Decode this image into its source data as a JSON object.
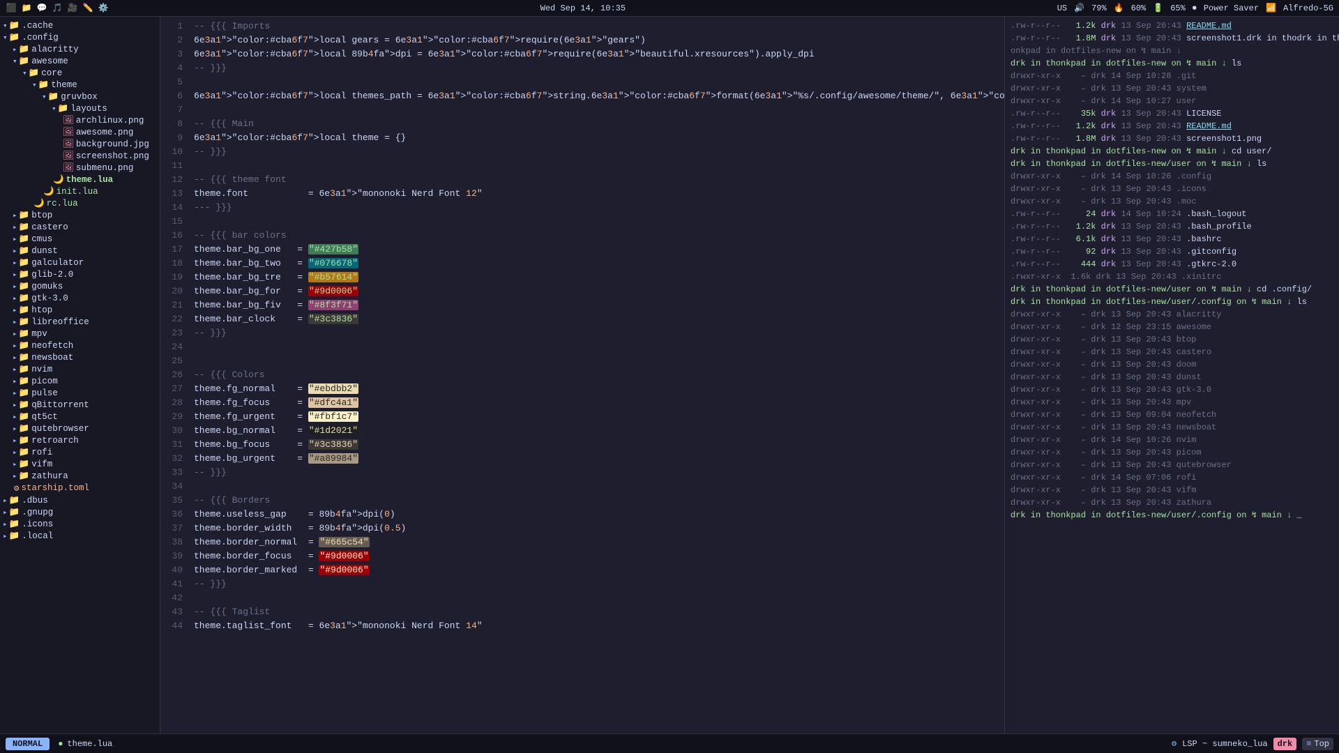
{
  "topbar": {
    "center": "Wed Sep 14, 10:35",
    "us_label": "US",
    "vol_label": "79%",
    "cpu_label": "60%",
    "battery_label": "65%",
    "power_label": "Power Saver",
    "wifi_label": "Alfredo-5G"
  },
  "sidebar": {
    "items": [
      {
        "label": ".cache",
        "type": "folder",
        "indent": 0,
        "expanded": true
      },
      {
        "label": ".config",
        "type": "folder",
        "indent": 0,
        "expanded": true
      },
      {
        "label": "alacritty",
        "type": "folder",
        "indent": 1,
        "expanded": false
      },
      {
        "label": "awesome",
        "type": "folder",
        "indent": 1,
        "expanded": true
      },
      {
        "label": "core",
        "type": "folder",
        "indent": 2,
        "expanded": true
      },
      {
        "label": "theme",
        "type": "folder",
        "indent": 3,
        "expanded": true
      },
      {
        "label": "gruvbox",
        "type": "folder",
        "indent": 4,
        "expanded": true
      },
      {
        "label": "layouts",
        "type": "folder",
        "indent": 5,
        "expanded": true
      },
      {
        "label": "archlinux.png",
        "type": "img",
        "indent": 6
      },
      {
        "label": "awesome.png",
        "type": "img",
        "indent": 6
      },
      {
        "label": "background.jpg",
        "type": "img",
        "indent": 6
      },
      {
        "label": "screenshot.png",
        "type": "img",
        "indent": 6
      },
      {
        "label": "submenu.png",
        "type": "img",
        "indent": 6
      },
      {
        "label": "theme.lua",
        "type": "lua-active",
        "indent": 5
      },
      {
        "label": "init.lua",
        "type": "lua",
        "indent": 4
      },
      {
        "label": "rc.lua",
        "type": "lua",
        "indent": 3
      },
      {
        "label": "btop",
        "type": "folder",
        "indent": 1,
        "expanded": false
      },
      {
        "label": "castero",
        "type": "folder",
        "indent": 1,
        "expanded": false
      },
      {
        "label": "cmus",
        "type": "folder",
        "indent": 1,
        "expanded": false
      },
      {
        "label": "dunst",
        "type": "folder",
        "indent": 1,
        "expanded": false
      },
      {
        "label": "galculator",
        "type": "folder",
        "indent": 1,
        "expanded": false
      },
      {
        "label": "glib-2.0",
        "type": "folder",
        "indent": 1,
        "expanded": false
      },
      {
        "label": "gomuks",
        "type": "folder",
        "indent": 1,
        "expanded": false
      },
      {
        "label": "gtk-3.0",
        "type": "folder",
        "indent": 1,
        "expanded": false
      },
      {
        "label": "htop",
        "type": "folder",
        "indent": 1,
        "expanded": false
      },
      {
        "label": "libreoffice",
        "type": "folder",
        "indent": 1,
        "expanded": false
      },
      {
        "label": "mpv",
        "type": "folder",
        "indent": 1,
        "expanded": false
      },
      {
        "label": "neofetch",
        "type": "folder",
        "indent": 1,
        "expanded": false
      },
      {
        "label": "newsboat",
        "type": "folder",
        "indent": 1,
        "expanded": false
      },
      {
        "label": "nvim",
        "type": "folder",
        "indent": 1,
        "expanded": false
      },
      {
        "label": "picom",
        "type": "folder",
        "indent": 1,
        "expanded": false
      },
      {
        "label": "pulse",
        "type": "folder",
        "indent": 1,
        "expanded": false
      },
      {
        "label": "qBittorrent",
        "type": "folder",
        "indent": 1,
        "expanded": false
      },
      {
        "label": "qt5ct",
        "type": "folder",
        "indent": 1,
        "expanded": false
      },
      {
        "label": "qutebrowser",
        "type": "folder",
        "indent": 1,
        "expanded": false
      },
      {
        "label": "retroarch",
        "type": "folder",
        "indent": 1,
        "expanded": false
      },
      {
        "label": "rofi",
        "type": "folder",
        "indent": 1,
        "expanded": false
      },
      {
        "label": "vifm",
        "type": "folder",
        "indent": 1,
        "expanded": false
      },
      {
        "label": "zathura",
        "type": "folder",
        "indent": 1,
        "expanded": false
      },
      {
        "label": "starship.toml",
        "type": "toml",
        "indent": 1
      },
      {
        "label": ".dbus",
        "type": "folder",
        "indent": 0,
        "expanded": false
      },
      {
        "label": ".gnupg",
        "type": "folder",
        "indent": 0,
        "expanded": false
      },
      {
        "label": ".icons",
        "type": "folder",
        "indent": 0,
        "expanded": false
      },
      {
        "label": ".local",
        "type": "folder",
        "indent": 0,
        "expanded": false
      }
    ]
  },
  "editor": {
    "filename": "theme.lua",
    "lines": [
      {
        "num": 1,
        "content": "-- {{{ Imports",
        "type": "comment"
      },
      {
        "num": 2,
        "content": "local gears = require(\"gears\")",
        "type": "code"
      },
      {
        "num": 3,
        "content": "local dpi = require(\"beautiful.xresources\").apply_dpi",
        "type": "code"
      },
      {
        "num": 4,
        "content": "-- }}}",
        "type": "comment"
      },
      {
        "num": 5,
        "content": "",
        "type": "blank"
      },
      {
        "num": 6,
        "content": "local themes_path = string.format(\"%s/.config/awesome/theme/\", os.getenv(\"HOME\"))",
        "type": "code"
      },
      {
        "num": 7,
        "content": "",
        "type": "blank"
      },
      {
        "num": 8,
        "content": "-- {{{ Main",
        "type": "comment"
      },
      {
        "num": 9,
        "content": "local theme = {}",
        "type": "code"
      },
      {
        "num": 10,
        "content": "-- }}}",
        "type": "comment"
      },
      {
        "num": 11,
        "content": "",
        "type": "blank"
      },
      {
        "num": 12,
        "content": "-- {{{ theme font",
        "type": "comment"
      },
      {
        "num": 13,
        "content": "theme.font           = \"mononoki Nerd Font 12\"",
        "type": "code"
      },
      {
        "num": 14,
        "content": "--- }}}",
        "type": "comment"
      },
      {
        "num": 15,
        "content": "",
        "type": "blank"
      },
      {
        "num": 16,
        "content": "-- {{{ bar colors",
        "type": "comment"
      },
      {
        "num": 17,
        "content": "theme.bar_bg_one   = \"#427b58\"",
        "type": "code",
        "highlight": "hl1"
      },
      {
        "num": 18,
        "content": "theme.bar_bg_two   = \"#076678\"",
        "type": "code",
        "highlight": "hl2"
      },
      {
        "num": 19,
        "content": "theme.bar_bg_tre   = \"#b57614\"",
        "type": "code",
        "highlight": "hl3"
      },
      {
        "num": 20,
        "content": "theme.bar_bg_for   = \"#9d0006\"",
        "type": "code",
        "highlight": "hl4"
      },
      {
        "num": 21,
        "content": "theme.bar_bg_fiv   = \"#8f3f71\"",
        "type": "code",
        "highlight": "hl5"
      },
      {
        "num": 22,
        "content": "theme.bar_clock    = \"#3c3836\"",
        "type": "code",
        "highlight": "hl6"
      },
      {
        "num": 23,
        "content": "-- }}}",
        "type": "comment"
      },
      {
        "num": 24,
        "content": "",
        "type": "blank"
      },
      {
        "num": 25,
        "content": "",
        "type": "blank"
      },
      {
        "num": 26,
        "content": "-- {{{ Colors",
        "type": "comment"
      },
      {
        "num": 27,
        "content": "theme.fg_normal    = \"#ebdbb2\"",
        "type": "code",
        "highlight": "hl7"
      },
      {
        "num": 28,
        "content": "theme.fg_focus     = \"#dfc4a1\"",
        "type": "code",
        "highlight": "hl8"
      },
      {
        "num": 29,
        "content": "theme.fg_urgent    = \"#fbf1c7\"",
        "type": "code",
        "highlight": "hl9"
      },
      {
        "num": 30,
        "content": "theme.bg_normal    = \"#1d2021\"",
        "type": "code",
        "highlight": "hla"
      },
      {
        "num": 31,
        "content": "theme.bg_focus     = \"#3c3836\"",
        "type": "code",
        "highlight": "hlb"
      },
      {
        "num": 32,
        "content": "theme.bg_urgent    = \"#a89984\"",
        "type": "code",
        "highlight": "hlc"
      },
      {
        "num": 33,
        "content": "-- }}}",
        "type": "comment"
      },
      {
        "num": 34,
        "content": "",
        "type": "blank"
      },
      {
        "num": 35,
        "content": "-- {{{ Borders",
        "type": "comment"
      },
      {
        "num": 36,
        "content": "theme.useless_gap    = dpi(0)",
        "type": "code"
      },
      {
        "num": 37,
        "content": "theme.border_width   = dpi(0.5)",
        "type": "code"
      },
      {
        "num": 38,
        "content": "theme.border_normal  = \"#665c54\"",
        "type": "code",
        "highlight": "hld"
      },
      {
        "num": 39,
        "content": "theme.border_focus   = \"#9d0006\"",
        "type": "code",
        "highlight": "hle"
      },
      {
        "num": 40,
        "content": "theme.border_marked  = \"#9d0006\"",
        "type": "code",
        "highlight": "hle"
      },
      {
        "num": 41,
        "content": "-- }}}",
        "type": "comment"
      },
      {
        "num": 42,
        "content": "",
        "type": "blank"
      },
      {
        "num": 43,
        "content": "-- {{{ Taglist",
        "type": "comment"
      },
      {
        "num": 44,
        "content": "theme.taglist_font   = \"mononoki Nerd Font 14\"",
        "type": "code"
      }
    ]
  },
  "terminal": {
    "lines": [
      ".rw-r--r--  1.2k drk 13 Sep 20:43 README.md",
      ".rw-r--r--  1.8M drk 13 Sep 20:43 screenshot1.drk in thodrk in th",
      "onkpad in dotfiles-new on ↯ main ↓",
      "drk in thonkpad in dotfiles-new on ↯ main ↓ ls",
      "drwxr-xr-x    – drk 14 Sep 10:28 .git",
      "drwxr-xr-x    – drk 13 Sep 20:43 system",
      "drwxr-xr-x    – drk 14 Sep 10:27 user",
      ".rw-r--r--   35k drk 13 Sep 20:43 LICENSE",
      ".rw-r--r--  1.2k drk 13 Sep 20:43 README.md",
      ".rw-r--r--  1.8M drk 13 Sep 20:43 screenshot1.png",
      "drk in thonkpad in dotfiles-new on ↯ main ↓ cd user/",
      "drk in thonkpad in dotfiles-new/user on ↯ main ↓ ls",
      "drwxr-xr-x    – drk 14 Sep 10:26 .config",
      "drwxr-xr-x    – drk 13 Sep 20:43 .icons",
      "drwxr-xr-x    – drk 13 Sep 20:43 .moc",
      ".rw-r--r--   24 drk 14 Sep 10:24 .bash_logout",
      ".rw-r--r--  1.2k drk 13 Sep 20:43 .bash_profile",
      ".rw-r--r--  6.1k drk 13 Sep 20:43 .bashrc",
      ".rw-r--r--   92 drk 13 Sep 20:43 .gitconfig",
      ".rw-r--r--  444 drk 13 Sep 20:43 .gtkrc-2.0",
      ".rwxr-xr-x  1.6k drk 13 Sep 20:43 .xinitrc",
      "drk in thonkpad in dotfiles-new/user on ↯ main ↓ cd .config/",
      "drk in thonkpad in dotfiles-new/user/.config on ↯ main ↓ ls",
      "drwxr-xr-x    – drk 13 Sep 20:43 alacritty",
      "drwxr-xr-x    – drk 12 Sep 23:15 awesome",
      "drwxr-xr-x    – drk 13 Sep 20:43 btop",
      "drwxr-xr-x    – drk 13 Sep 20:43 castero",
      "drwxr-xr-x    – drk 13 Sep 20:43 doom",
      "drwxr-xr-x    – drk 13 Sep 20:43 dunst",
      "drwxr-xr-x    – drk 13 Sep 20:43 gtk-3.0",
      "drwxr-xr-x    – drk 13 Sep 20:43 mpv",
      "drwxr-xr-x    – drk 13 Sep 09:04 neofetch",
      "drwxr-xr-x    – drk 13 Sep 20:43 newsboat",
      "drwxr-xr-x    – drk 14 Sep 10:26 nvim",
      "drwxr-xr-x    – drk 13 Sep 20:43 picom",
      "drwxr-xr-x    – drk 13 Sep 20:43 qutebrowser",
      "drwxr-xr-x    – drk 14 Sep 07:06 rofi",
      "drwxr-xr-x    – drk 13 Sep 20:43 vifm",
      "drwxr-xr-x    – drk 13 Sep 20:43 zathura",
      "drk in thonkpad in dotfiles-new/user/.config on ↯ main ↓ _"
    ]
  },
  "statusbar": {
    "mode": "NORMAL",
    "file_icon": "●",
    "filename": "theme.lua",
    "lsp_label": "LSP ~ sumneko_lua",
    "drk_label": "drk",
    "top_label": "Top"
  }
}
